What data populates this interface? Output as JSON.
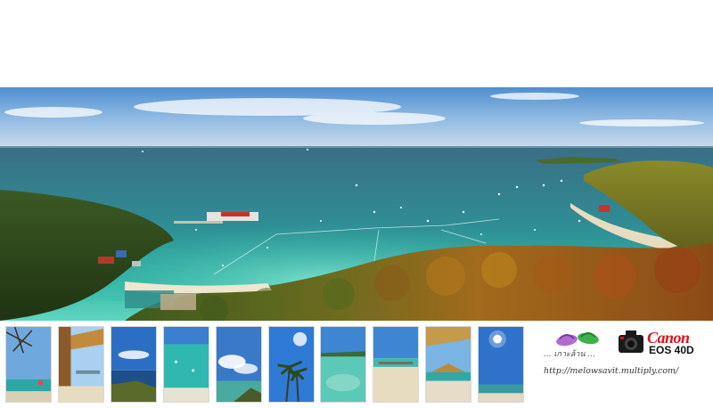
{
  "panorama": {
    "description_icon": "island-bay-panorama"
  },
  "thumbnails": [
    {
      "name": "thumb-tree-beach",
      "icon": "photo-icon"
    },
    {
      "name": "thumb-thatched-hut",
      "icon": "photo-icon"
    },
    {
      "name": "thumb-sea-cliff",
      "icon": "photo-icon"
    },
    {
      "name": "thumb-turquoise-water",
      "icon": "photo-icon"
    },
    {
      "name": "thumb-clouds-sea",
      "icon": "photo-icon"
    },
    {
      "name": "thumb-palm-trees",
      "icon": "photo-icon"
    },
    {
      "name": "thumb-shallow-water",
      "icon": "photo-icon"
    },
    {
      "name": "thumb-sandy-beach",
      "icon": "photo-icon"
    },
    {
      "name": "thumb-beach-shelter",
      "icon": "photo-icon"
    },
    {
      "name": "thumb-sun-sky",
      "icon": "photo-icon"
    }
  ],
  "branding": {
    "camera_brand": "Canon",
    "camera_model": "EOS 40D",
    "caption": "... เกาะล้าน ...",
    "url": "http://melowsavit.multiply.com/",
    "colors": {
      "canon_red": "#d8121b",
      "sandal_purple": "#b06cd0",
      "sandal_green": "#3cb34a"
    }
  }
}
